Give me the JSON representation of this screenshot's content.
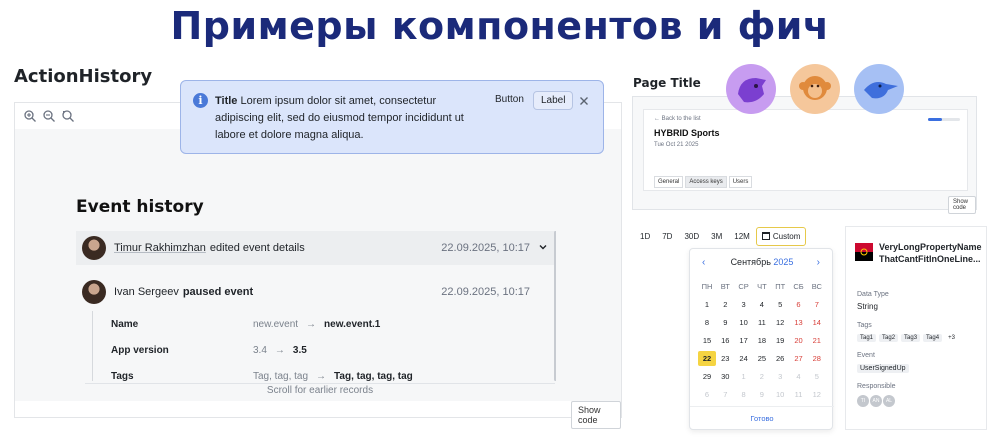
{
  "headline": "Примеры компонентов и фич",
  "action_history": {
    "section_title": "ActionHistory",
    "toolbar": {
      "zoom_in_icon": "zoom-in-icon",
      "zoom_out_icon": "zoom-out-icon",
      "reset_icon": "reset-zoom-icon"
    },
    "event_history": {
      "title": "Event history",
      "rows": [
        {
          "name": "Timur Rakhimzhan",
          "action": "edited event details",
          "date": "22.09.2025, 10:17"
        },
        {
          "name": "Ivan Sergeev",
          "action": "paused event",
          "date": "22.09.2025, 10:17"
        }
      ],
      "details": [
        {
          "key": "Name",
          "old": "new.event",
          "arrow": "→",
          "new": "new.event.1"
        },
        {
          "key": "App version",
          "old": "3.4",
          "arrow": "→",
          "new": "3.5"
        },
        {
          "key": "Tags",
          "old": "Tag, tag, tag",
          "arrow": "→",
          "new": "Tag, tag, tag, tag"
        }
      ],
      "scroll_hint": "Scroll for earlier records"
    },
    "show_code": "Show code"
  },
  "toast": {
    "title": "Title",
    "text": "Lorem ipsum dolor sit amet, consectetur adipiscing elit, sed do eiusmod tempor incididunt ut labore et dolore magna aliqua.",
    "button_label": "Button",
    "label_button": "Label",
    "info_glyph": "i"
  },
  "page_title": {
    "section_title": "Page Title",
    "back_link": "← Back to the list",
    "name": "HYBRID Sports",
    "date": "Tue Oct 21 2025",
    "tabs": [
      "General",
      "Access keys",
      "Users"
    ],
    "progress": 0.45,
    "show_code": "Show code"
  },
  "date_range": {
    "options": [
      "1D",
      "7D",
      "30D",
      "3M",
      "12M",
      "Custom"
    ],
    "selected": "Custom"
  },
  "calendar": {
    "month": "Сентябрь",
    "year": "2025",
    "weekdays": [
      "ПН",
      "ВТ",
      "СР",
      "ЧТ",
      "ПТ",
      "СБ",
      "ВС"
    ],
    "weeks": [
      [
        "1",
        "2",
        "3",
        "4",
        "5",
        "6",
        "7"
      ],
      [
        "8",
        "9",
        "10",
        "11",
        "12",
        "13",
        "14"
      ],
      [
        "15",
        "16",
        "17",
        "18",
        "19",
        "20",
        "21"
      ],
      [
        "22",
        "23",
        "24",
        "25",
        "26",
        "27",
        "28"
      ],
      [
        "29",
        "30",
        "1",
        "2",
        "3",
        "4",
        "5"
      ],
      [
        "6",
        "7",
        "8",
        "9",
        "10",
        "11",
        "12"
      ]
    ],
    "today": "22",
    "done": "Готово"
  },
  "property_card": {
    "name_line1": "VeryLongPropertyName",
    "name_line2": "ThatCantFitInOneLine...",
    "data_type_label": "Data Type",
    "data_type": "String",
    "tags_label": "Tags",
    "tags": [
      "Tag1",
      "Tag2",
      "Tag3",
      "Tag4",
      "+3"
    ],
    "event_label": "Event",
    "event": "UserSignedUp",
    "responsible_label": "Responsible",
    "responsible": [
      "TI",
      "AN",
      "AL"
    ]
  }
}
